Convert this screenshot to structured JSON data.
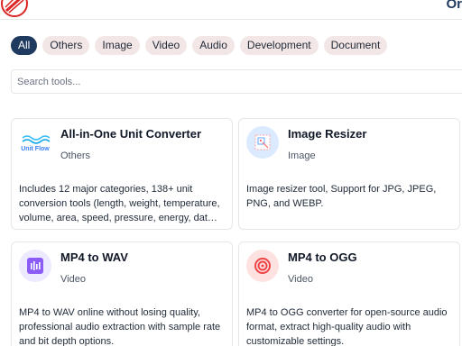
{
  "header": {
    "partial_text": "Or"
  },
  "filters": [
    {
      "label": "All",
      "active": true
    },
    {
      "label": "Others",
      "active": false
    },
    {
      "label": "Image",
      "active": false
    },
    {
      "label": "Video",
      "active": false
    },
    {
      "label": "Audio",
      "active": false
    },
    {
      "label": "Development",
      "active": false
    },
    {
      "label": "Document",
      "active": false
    }
  ],
  "search": {
    "placeholder": "Search tools...",
    "value": ""
  },
  "cards": [
    {
      "title": "All-in-One Unit Converter",
      "category": "Others",
      "description": "Includes 12 major categories, 138+ unit conversion tools (length, weight, temperature, volume, area, speed, pressure, energy, data storage and more)",
      "icon": "unit-flow-logo",
      "icon_text": "Unit Flow"
    },
    {
      "title": "Image Resizer",
      "category": "Image",
      "description": "Image resizer tool, Support for JPG, JPEG, PNG, and WEBP.",
      "icon": "image-resize-icon"
    },
    {
      "title": "MP4 to WAV",
      "category": "Video",
      "description": "MP4 to WAV online without losing quality, professional audio extraction with sample rate and bit depth options.",
      "icon": "audio-bars-icon"
    },
    {
      "title": "MP4 to OGG",
      "category": "Video",
      "description": "MP4 to OGG converter for open-source audio format, extract high-quality audio with customizable settings.",
      "icon": "target-icon"
    }
  ],
  "colors": {
    "accent": "#1e3a5f",
    "pill_bg": "#f3e6e6",
    "border": "#e5e7eb"
  }
}
